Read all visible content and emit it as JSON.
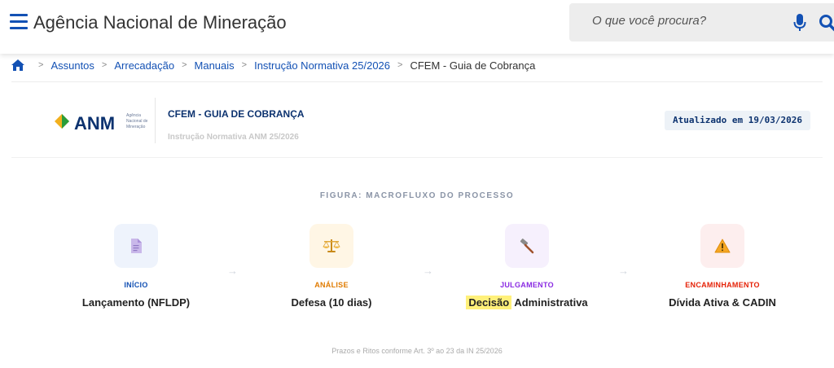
{
  "header": {
    "site_title": "Agência Nacional de Mineração",
    "search_placeholder": "O que você procura?"
  },
  "breadcrumb": {
    "items": [
      "Assuntos",
      "Arrecadação",
      "Manuais",
      "Instrução Normativa 25/2026"
    ],
    "current": "CFEM - Guia de Cobrança",
    "separator": ">"
  },
  "document": {
    "logo_text": "ANM",
    "logo_subtext": [
      "Agência",
      "Nacional de",
      "Mineração"
    ],
    "title": "CFEM - GUIA DE COBRANÇA",
    "subtitle": "Instrução Normativa ANM 25/2026",
    "updated": "Atualizado em 19/03/2026"
  },
  "figure": {
    "caption": "FIGURA: MACROFLUXO DO PROCESSO",
    "steps": [
      {
        "label": "INÍCIO",
        "text": "Lançamento (NFLDP)",
        "icon": "document-icon",
        "label_color": "#1351b4",
        "bg_color": "#eef3fc"
      },
      {
        "label": "ANÁLISE",
        "text": "Defesa (10 dias)",
        "icon": "scales-icon",
        "label_color": "#e07b00",
        "bg_color": "#fff6e5"
      },
      {
        "label": "JULGAMENTO",
        "text_highlight": "Decisão",
        "text_rest": " Administrativa",
        "icon": "gavel-icon",
        "label_color": "#8a2be2",
        "bg_color": "#f6f0fd"
      },
      {
        "label": "ENCAMINHAMENTO",
        "text": "Dívida Ativa & CADIN",
        "icon": "warning-icon",
        "label_color": "#e52207",
        "bg_color": "#fdeeee"
      }
    ],
    "arrow": "→",
    "footnote": "Prazos e Ritos conforme Art. 3º ao 23 da IN 25/2026"
  },
  "colors": {
    "primary": "#1351b4",
    "dark_blue": "#0c326f",
    "highlight": "#fff07a"
  }
}
